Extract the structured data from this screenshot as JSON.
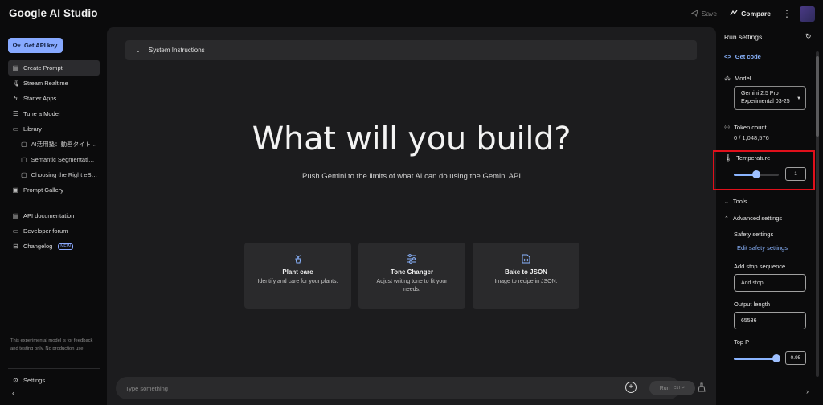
{
  "app": {
    "title": "Google AI Studio"
  },
  "top_actions": {
    "save_label": "Save",
    "compare_label": "Compare"
  },
  "sidebar": {
    "api_key_label": "Get API key",
    "items": [
      {
        "label": "Create Prompt",
        "icon": "create-prompt-icon",
        "active": true
      },
      {
        "label": "Stream Realtime",
        "icon": "microphone-icon"
      },
      {
        "label": "Starter Apps",
        "icon": "bolt-icon"
      },
      {
        "label": "Tune a Model",
        "icon": "tune-icon"
      },
      {
        "label": "Library",
        "icon": "folder-icon"
      }
    ],
    "library_items": [
      "AI活用塾：動画タイト…",
      "Semantic Segmentati…",
      "Choosing the Right eB…"
    ],
    "prompt_gallery_label": "Prompt Gallery",
    "docs_label": "API documentation",
    "forum_label": "Developer forum",
    "changelog_label": "Changelog",
    "new_badge": "NEW",
    "disclaimer": "This experimental model is for feedback and testing only. No production use.",
    "settings_label": "Settings"
  },
  "main": {
    "system_instructions_label": "System Instructions",
    "headline": "What will you build?",
    "subheadline": "Push Gemini to the limits of what AI can do using the Gemini API",
    "cards": [
      {
        "title": "Plant care",
        "desc": "Identify and care for your plants.",
        "icon": "plant-icon"
      },
      {
        "title": "Tone Changer",
        "desc": "Adjust writing tone to fit your needs.",
        "icon": "sliders-icon"
      },
      {
        "title": "Bake to JSON",
        "desc": "Image to recipe in JSON.",
        "icon": "json-file-icon"
      }
    ],
    "composer_placeholder": "Type something",
    "run_label": "Run",
    "run_shortcut": "Ctrl ↵"
  },
  "run_settings": {
    "title": "Run settings",
    "get_code_label": "Get code",
    "model_label": "Model",
    "model_value_line1": "Gemini 2.5 Pro",
    "model_value_line2": "Experimental 03-25",
    "token_count_label": "Token count",
    "token_count_value": "0 / 1,048,576",
    "temperature_label": "Temperature",
    "temperature_value": "1",
    "temperature_fraction": 0.5,
    "tools_label": "Tools",
    "advanced_label": "Advanced settings",
    "safety_label": "Safety settings",
    "edit_safety_label": "Edit safety settings",
    "stop_sequence_label": "Add stop sequence",
    "stop_sequence_placeholder": "Add stop...",
    "output_length_label": "Output length",
    "output_length_value": "65536",
    "top_p_label": "Top P",
    "top_p_value": "0.95",
    "top_p_fraction": 0.95
  },
  "colors": {
    "accent": "#8ab4ff",
    "highlight_box": "#e0101b",
    "background": "#0b0b0c",
    "panel": "#1c1c1e"
  }
}
